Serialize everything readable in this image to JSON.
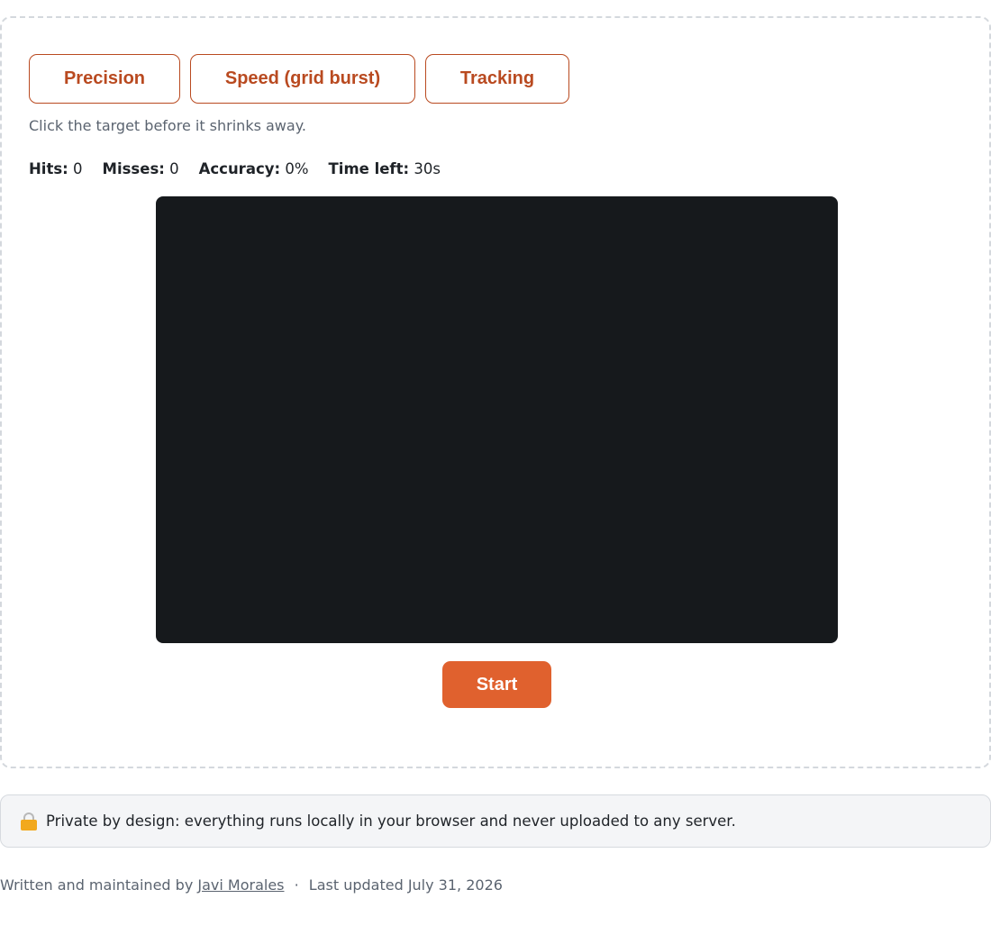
{
  "modes": {
    "precision_label": "Precision",
    "speed_label": "Speed (grid burst)",
    "tracking_label": "Tracking"
  },
  "hint": "Click the target before it shrinks away.",
  "stats": {
    "hits_label": "Hits:",
    "hits_value": "0",
    "misses_label": "Misses:",
    "misses_value": "0",
    "accuracy_label": "Accuracy:",
    "accuracy_value": "0%",
    "time_label": "Time left:",
    "time_value": "30s"
  },
  "start_label": "Start",
  "privacy": {
    "icon": "lock-icon",
    "text": "Private by design: everything runs locally in your browser and never uploaded to any server."
  },
  "footer": {
    "written_by": "Written and maintained by",
    "author": "Javi Morales",
    "separator": "·",
    "updated": "Last updated July 31, 2026"
  },
  "colors": {
    "accent": "#e0612e",
    "accent_dark": "#b94a20",
    "arena_bg": "#16191c"
  }
}
